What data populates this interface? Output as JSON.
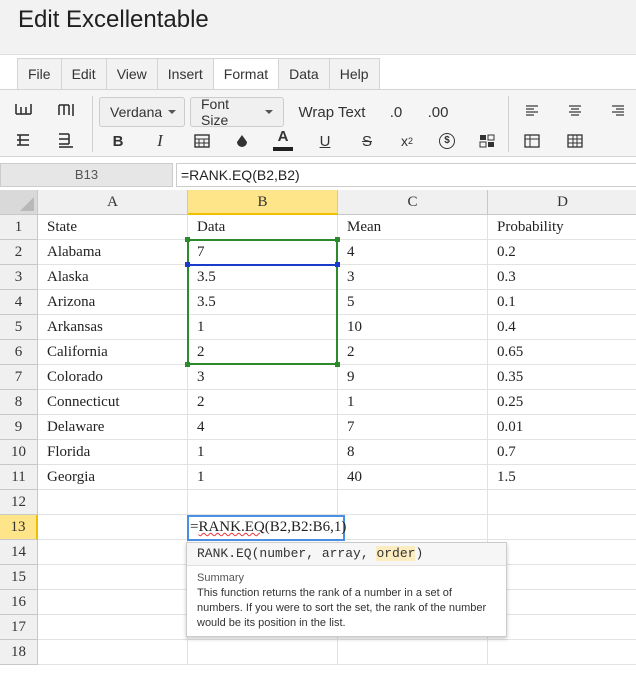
{
  "app": {
    "title": "Edit Excellentable"
  },
  "menu": [
    "File",
    "Edit",
    "View",
    "Insert",
    "Format",
    "Data",
    "Help"
  ],
  "menu_active": "Format",
  "toolbar": {
    "font_family": "Verdana",
    "font_size": "Font Size",
    "wrap_text": "Wrap Text",
    "decimal_decrease": ".0",
    "decimal_increase": ".00",
    "bold": "B",
    "italic": "I",
    "font_color": "A",
    "underline": "U",
    "strikethrough": "S",
    "superscript_base": "x",
    "superscript_exp": "2",
    "currency": "$",
    "accent_color": "#202020"
  },
  "formula_bar": {
    "name_box": "B13",
    "formula": "=RANK.EQ(B2,B2)"
  },
  "columns": [
    "A",
    "B",
    "C",
    "D"
  ],
  "selected_column": "B",
  "rows": [
    {
      "num": "1",
      "cells": [
        "State",
        "Data",
        "Mean",
        "Probability"
      ]
    },
    {
      "num": "2",
      "cells": [
        "Alabama",
        "7",
        "4",
        "0.2"
      ]
    },
    {
      "num": "3",
      "cells": [
        "Alaska",
        "3.5",
        "3",
        "0.3"
      ]
    },
    {
      "num": "4",
      "cells": [
        "Arizona",
        "3.5",
        "5",
        "0.1"
      ]
    },
    {
      "num": "5",
      "cells": [
        "Arkansas",
        "1",
        "10",
        "0.4"
      ]
    },
    {
      "num": "6",
      "cells": [
        "California",
        "2",
        "2",
        "0.65"
      ]
    },
    {
      "num": "7",
      "cells": [
        "Colorado",
        "3",
        "9",
        "0.35"
      ]
    },
    {
      "num": "8",
      "cells": [
        "Connecticut",
        "2",
        "1",
        "0.25"
      ]
    },
    {
      "num": "9",
      "cells": [
        "Delaware",
        "4",
        "7",
        "0.01"
      ]
    },
    {
      "num": "10",
      "cells": [
        "Florida",
        "1",
        "8",
        "0.7"
      ]
    },
    {
      "num": "11",
      "cells": [
        "Georgia",
        "1",
        "40",
        "1.5"
      ]
    },
    {
      "num": "12",
      "cells": [
        "",
        "",
        "",
        ""
      ]
    },
    {
      "num": "13",
      "cells": [
        "",
        "",
        "",
        ""
      ]
    },
    {
      "num": "14",
      "cells": [
        "",
        "",
        "",
        ""
      ]
    },
    {
      "num": "15",
      "cells": [
        "",
        "",
        "",
        ""
      ]
    },
    {
      "num": "16",
      "cells": [
        "",
        "",
        "",
        ""
      ]
    },
    {
      "num": "17",
      "cells": [
        "",
        "",
        "",
        ""
      ]
    },
    {
      "num": "18",
      "cells": [
        "",
        "",
        "",
        ""
      ]
    }
  ],
  "selected_row": "13",
  "editor": {
    "prefix": "=",
    "func": "RANK.EQ",
    "args": "(B2,B2:B6,1)"
  },
  "tooltip": {
    "sig_pre": "RANK.EQ(number, array, ",
    "sig_hl": "order",
    "sig_post": ")",
    "summary_label": "Summary",
    "description": "This function returns the rank of a number in a set of numbers. If you were to sort the set, the rank of the number would be its position in the list."
  }
}
